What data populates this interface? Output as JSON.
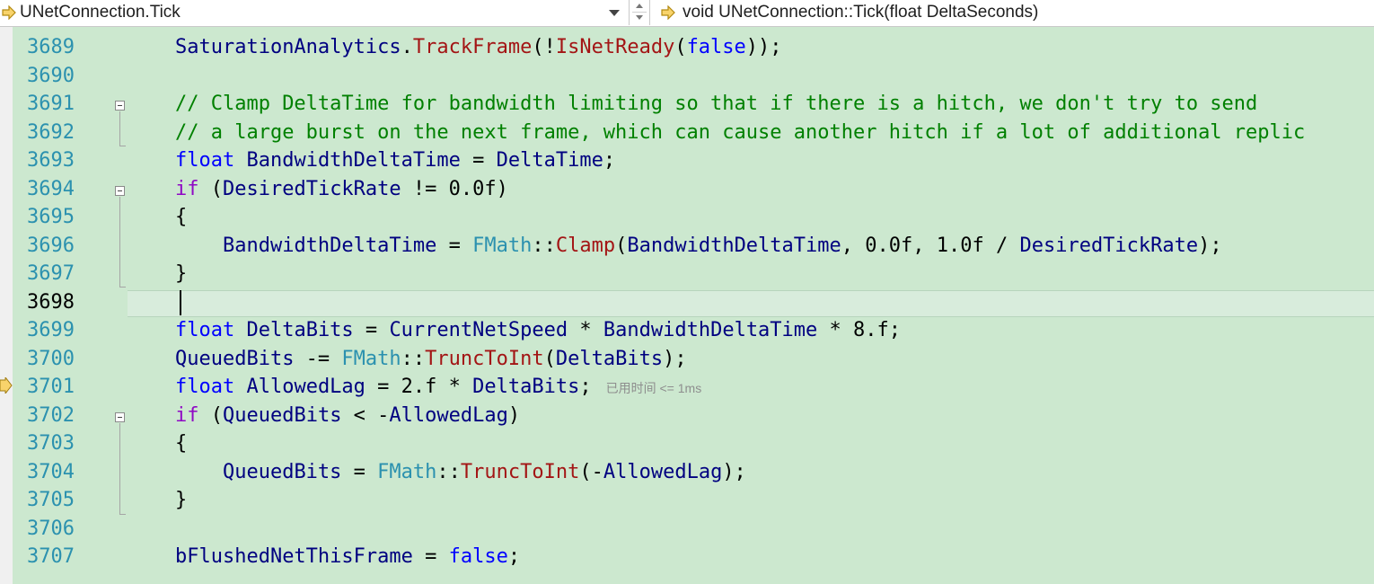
{
  "navbar": {
    "left_dropdown": "UNetConnection.Tick",
    "right_dropdown": "void UNetConnection::Tick(float DeltaSeconds)"
  },
  "editor": {
    "current_line": "3698",
    "lines": [
      {
        "n": "3689"
      },
      {
        "n": "3690"
      },
      {
        "n": "3691"
      },
      {
        "n": "3692"
      },
      {
        "n": "3693"
      },
      {
        "n": "3694"
      },
      {
        "n": "3695"
      },
      {
        "n": "3696"
      },
      {
        "n": "3697"
      },
      {
        "n": "3698"
      },
      {
        "n": "3699"
      },
      {
        "n": "3700"
      },
      {
        "n": "3701"
      },
      {
        "n": "3702"
      },
      {
        "n": "3703"
      },
      {
        "n": "3704"
      },
      {
        "n": "3705"
      },
      {
        "n": "3706"
      },
      {
        "n": "3707"
      }
    ],
    "perf_tip": "已用时间 <= 1ms"
  },
  "colors": {
    "background": "#cce8cf",
    "line_number": "#2b91af",
    "keyword": "#0000ff",
    "control_keyword": "#8f08c4",
    "function": "#a31515",
    "variable": "#000080",
    "comment": "#008000",
    "type": "#2b91af"
  },
  "icons": {
    "nav_left": "arrow-right-outline-icon",
    "nav_right": "arrow-right-outline-icon",
    "execution_pointer": "instruction-pointer-arrow-icon"
  }
}
